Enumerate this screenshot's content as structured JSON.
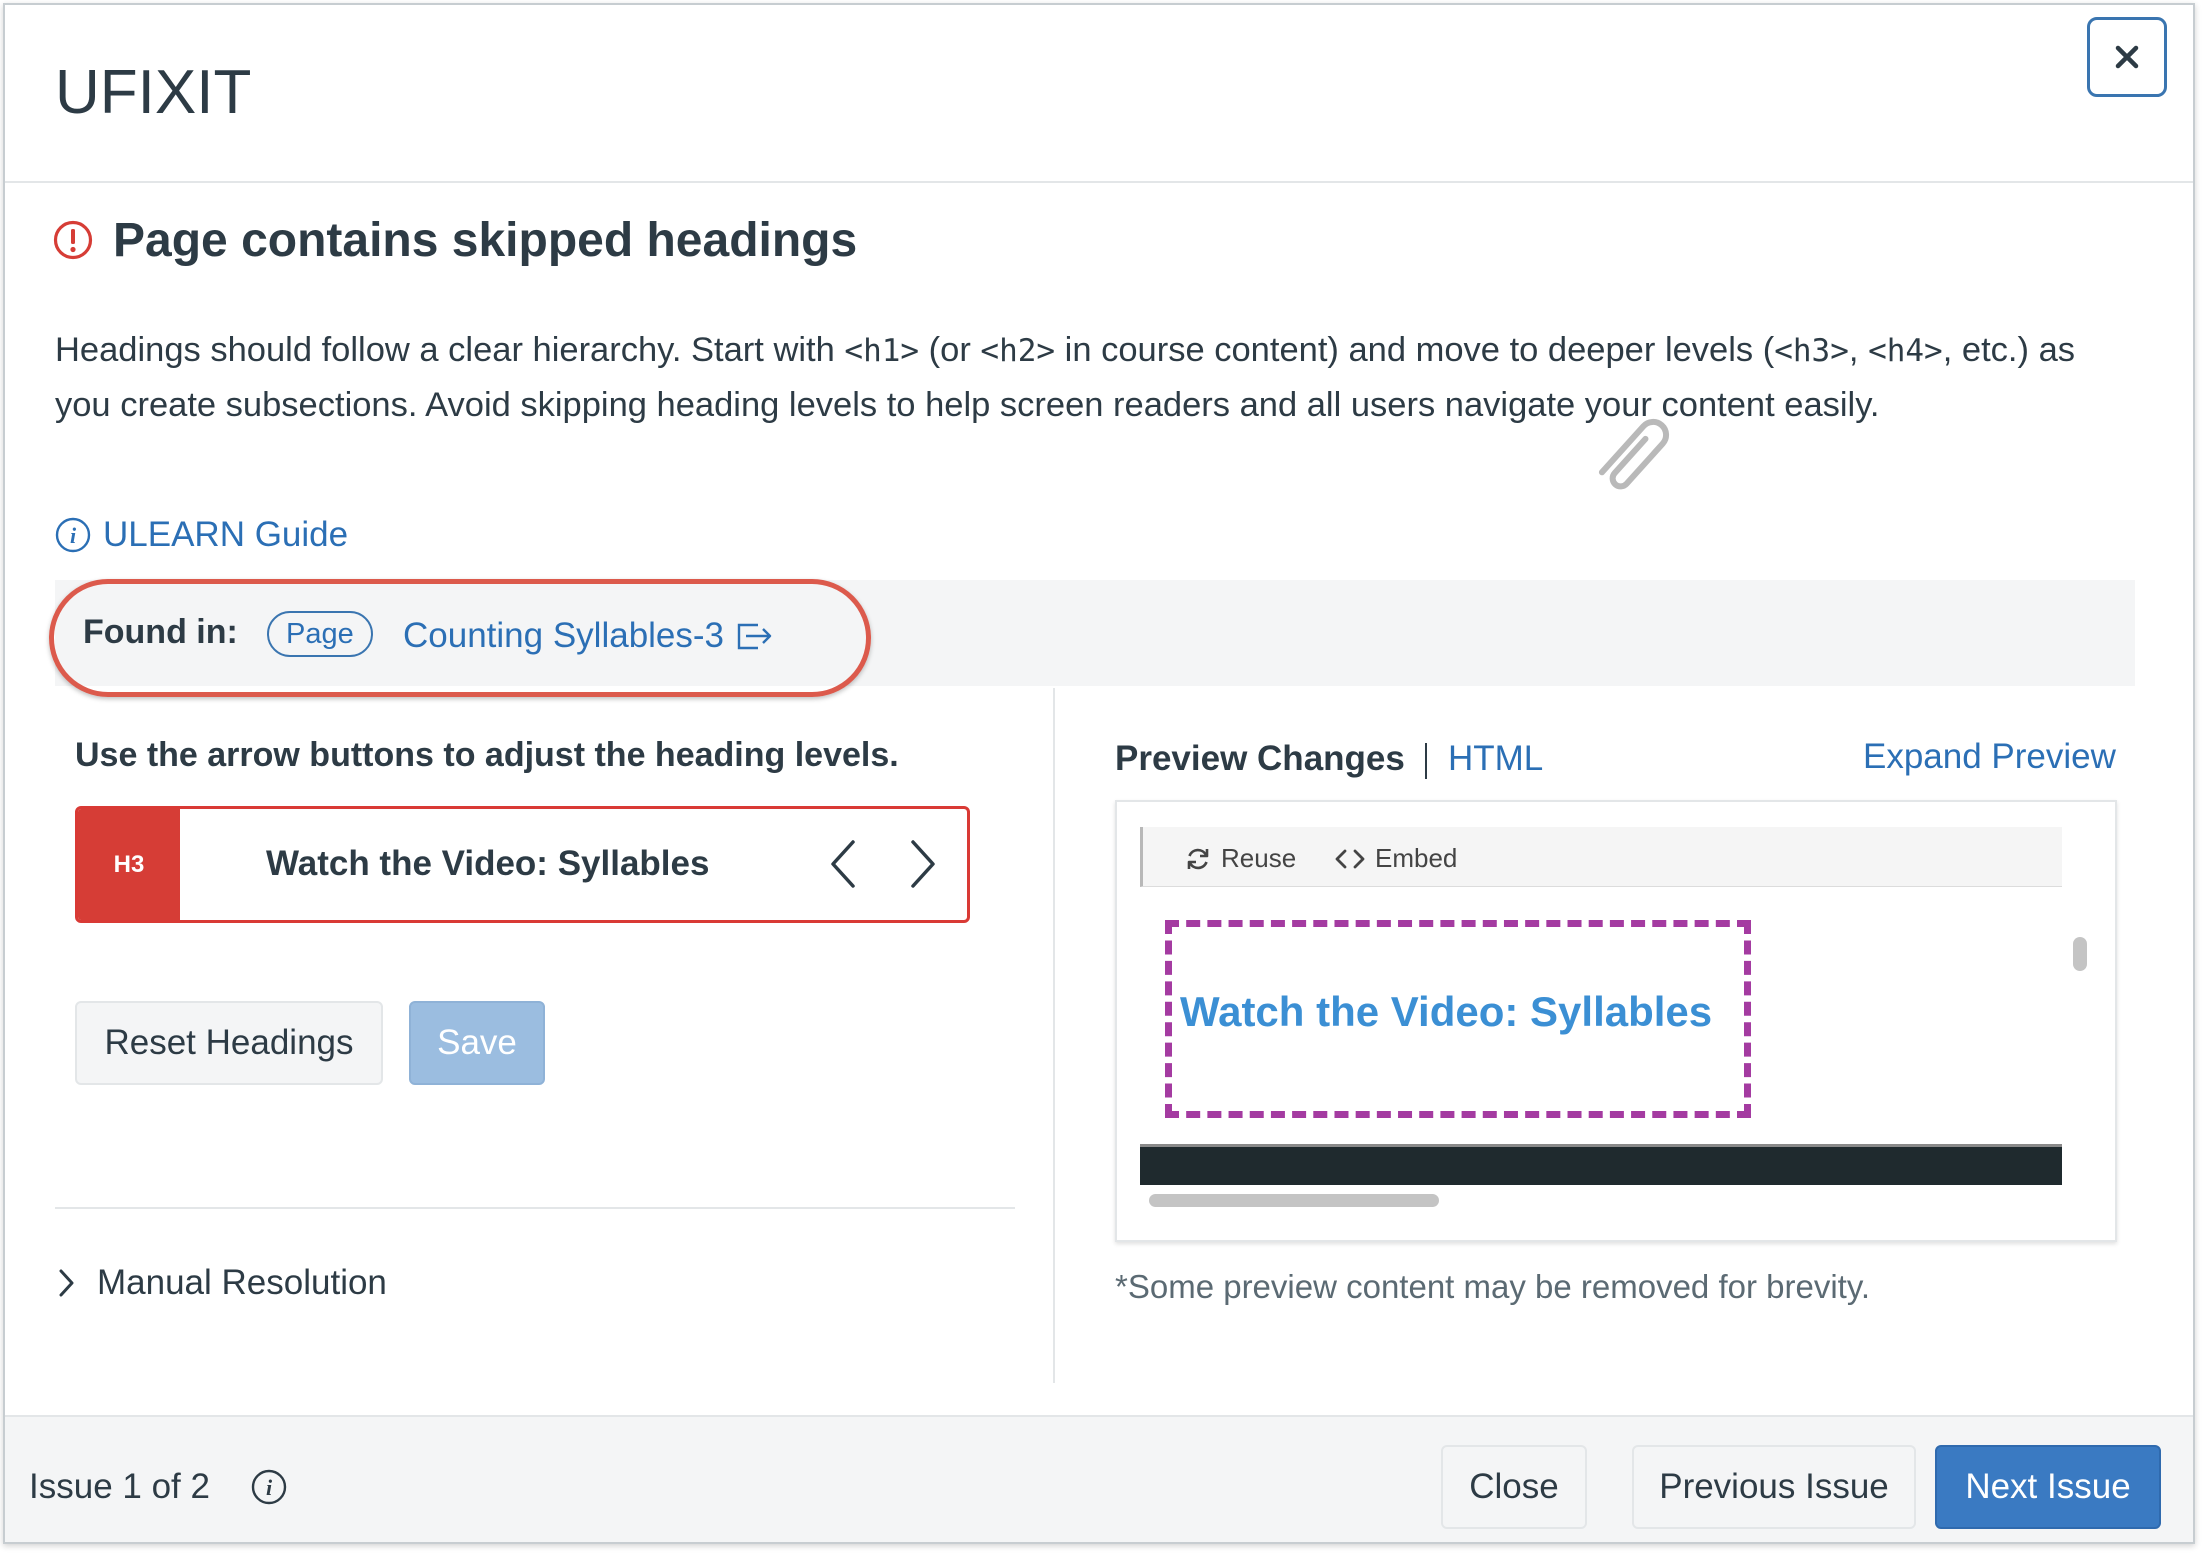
{
  "app": {
    "title": "UFIXIT",
    "close_icon": "close-icon"
  },
  "issue": {
    "title": "Page contains skipped headings",
    "desc_part1": "Headings should follow a clear hierarchy. Start with ",
    "code_h1": "<h1>",
    "desc_part2": " (or ",
    "code_h2": "<h2>",
    "desc_part3": " in course content) and move to deeper levels (",
    "code_h3": "<h3>",
    "desc_part4": ", ",
    "code_h4": "<h4>",
    "desc_part5": ", etc.) as you create subsections. Avoid skipping heading levels to help screen readers and all users navigate your content easily.",
    "guide_link": "ULEARN Guide"
  },
  "found_in": {
    "label": "Found in:",
    "type_badge": "Page",
    "link_text": "Counting Syllables-3"
  },
  "editor": {
    "instruction": "Use the arrow buttons to adjust the heading levels.",
    "level_badge": "H3",
    "heading_text": "Watch the Video: Syllables",
    "reset_label": "Reset Headings",
    "save_label": "Save",
    "manual_resolution": "Manual Resolution"
  },
  "preview": {
    "tab_preview": "Preview Changes",
    "tab_html": "HTML",
    "expand": "Expand Preview",
    "toolbar_reuse": "Reuse",
    "toolbar_embed": "Embed",
    "heading": "Watch the Video: Syllables",
    "note": "*Some preview content may be removed for brevity."
  },
  "footer": {
    "issue_count": "Issue 1 of 2",
    "close_label": "Close",
    "previous_label": "Previous Issue",
    "next_label": "Next Issue"
  },
  "colors": {
    "accent": "#2b6fb5",
    "error": "#d63d36",
    "highlight_oval": "#dc5a4c",
    "preview_outline": "#a43ba1",
    "primary_button": "#3a7ac2"
  }
}
